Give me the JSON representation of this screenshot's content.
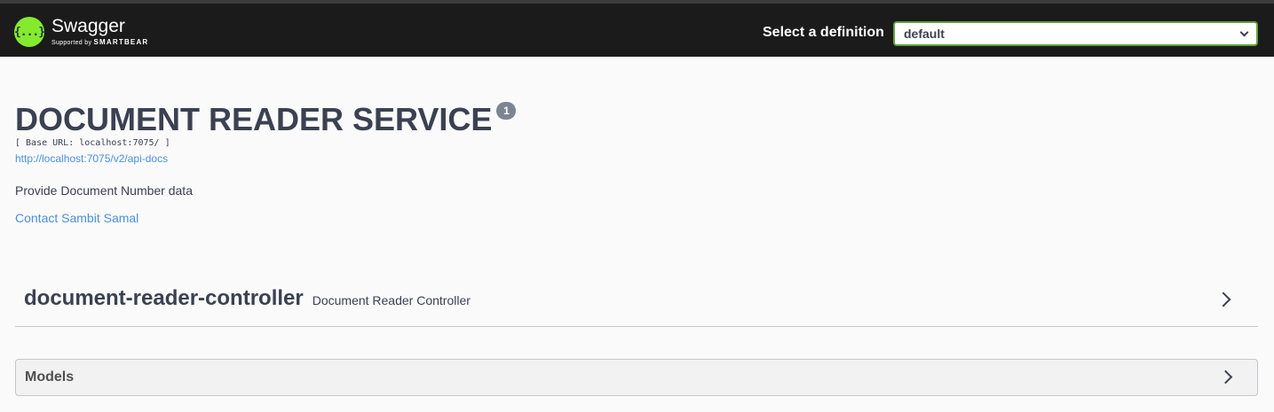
{
  "topbar": {
    "logo_glyph": "{...}",
    "logo_name": "Swagger",
    "logo_supported_prefix": "Supported by",
    "logo_supported_brand": "SMARTBEAR",
    "definition_label": "Select a definition",
    "definition_selected": "default"
  },
  "info": {
    "title": "DOCUMENT READER SERVICE",
    "version": "1",
    "base_url": "[ Base URL: localhost:7075/ ]",
    "api_docs_link": "http://localhost:7075/v2/api-docs",
    "description": "Provide Document Number data",
    "contact": "Contact Sambit Samal"
  },
  "tags": [
    {
      "name": "document-reader-controller",
      "description": "Document Reader Controller"
    }
  ],
  "models": {
    "title": "Models"
  },
  "colors": {
    "topbar_bg": "#1b1b1b",
    "logo_green": "#85ea2d",
    "select_border": "#62a03f",
    "link": "#4990e2",
    "text": "#3b4151"
  }
}
